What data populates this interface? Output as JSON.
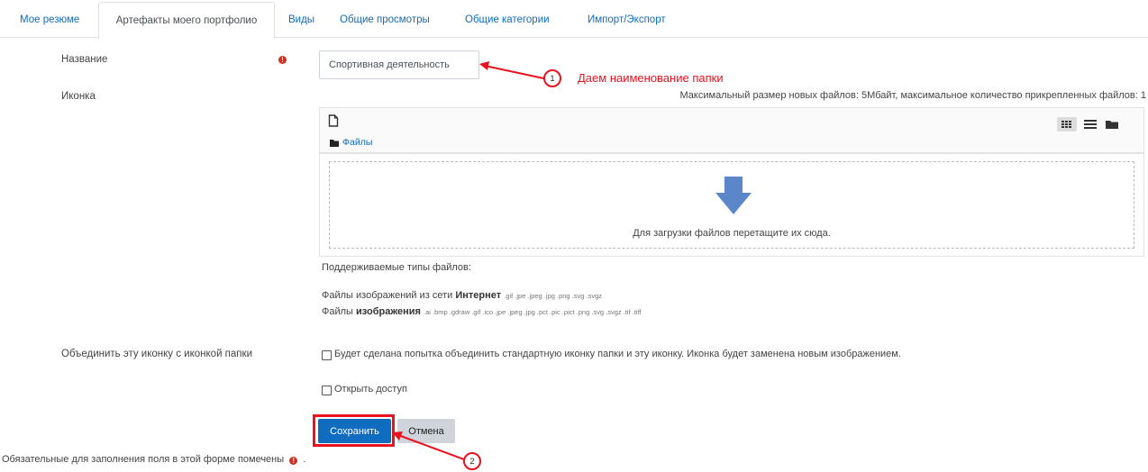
{
  "tabs": [
    {
      "label": "Мое резюме",
      "active": false
    },
    {
      "label": "Артефакты моего портфолио",
      "active": true
    },
    {
      "label": "Виды",
      "active": false
    },
    {
      "label": "Общие просмотры",
      "active": false
    },
    {
      "label": "Общие категории",
      "active": false
    },
    {
      "label": "Импорт/Экспорт",
      "active": false
    }
  ],
  "form": {
    "name_label": "Название",
    "name_value": "Спортивная деятельность",
    "icon_label": "Иконка",
    "max_size_text": "Максимальный размер новых файлов: 5Мбайт, максимальное количество прикрепленных файлов: 1",
    "files_folder": "Файлы",
    "drop_text": "Для загрузки файлов перетащите их сюда.",
    "supported_types_label": "Поддерживаемые типы файлов:",
    "file_types": [
      {
        "name": "Файлы изображений из сети ",
        "bold": "Интернет",
        "ext": ".gif .jpe .jpeg .jpg .png .svg .svgz"
      },
      {
        "name": "Файлы ",
        "bold": "изображения",
        "ext": ".ai .bmp .gdraw .gif .ico .jpe .jpeg .jpg .pct .pic .pict .png .svg .svgz .tif .tiff"
      }
    ],
    "merge_label": "Объединить эту иконку с иконкой папки",
    "merge_checkbox_text": "Будет сделана попытка объединить стандартную иконку папки и эту иконку. Иконка будет заменена новым изображением.",
    "access_checkbox_text": "Открыть доступ",
    "save_button": "Сохранить",
    "cancel_button": "Отмена",
    "required_note": "Обязательные для заполнения поля в этой форме помечены",
    "required_note_end": "."
  },
  "annotations": {
    "step1_number": "1",
    "step1_text": "Даем наименование папки",
    "step2_number": "2"
  },
  "colors": {
    "link": "#0f6cbf",
    "primary_button": "#0f6cbf",
    "required": "#ca3120",
    "annotation": "#e8131f"
  }
}
